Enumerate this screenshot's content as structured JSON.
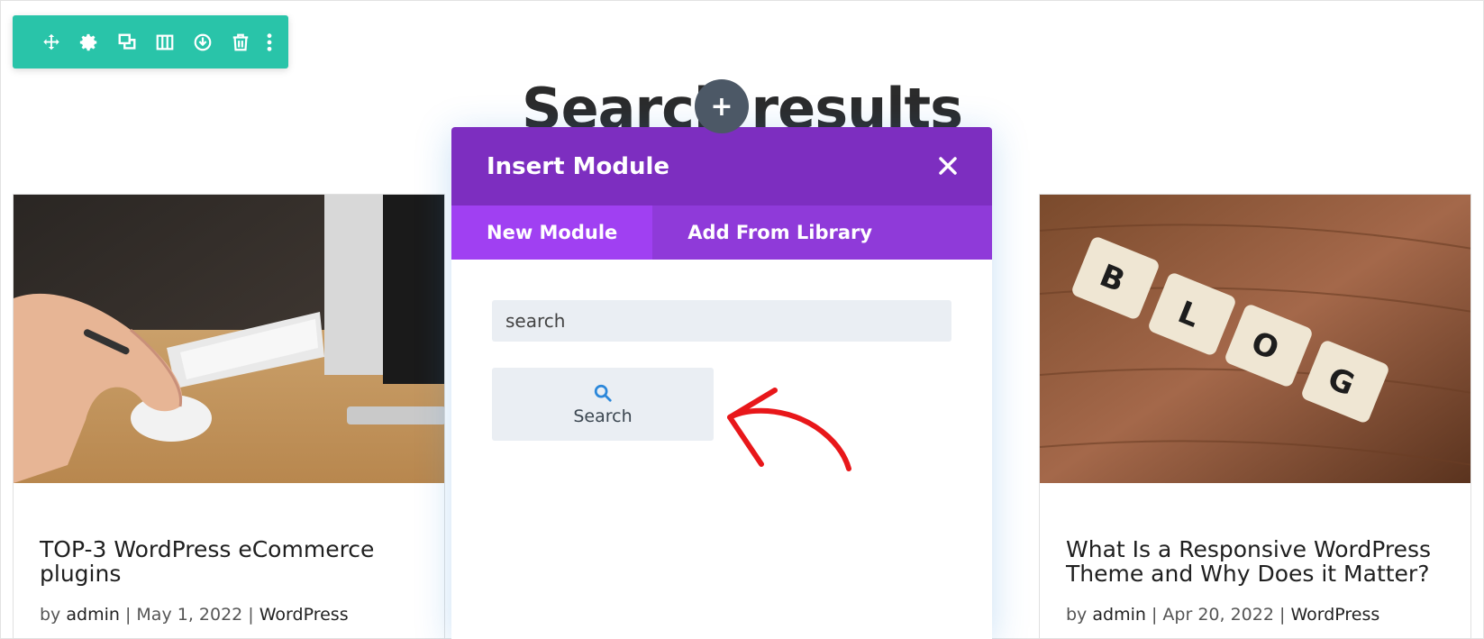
{
  "toolbar": {
    "icons": [
      "move-icon",
      "gear-icon",
      "duplicate-icon",
      "columns-icon",
      "save-to-library-icon",
      "trash-icon",
      "more-icon"
    ]
  },
  "section": {
    "title": "Search results"
  },
  "modal": {
    "title": "Insert Module",
    "tabs": [
      {
        "label": "New Module",
        "active": true
      },
      {
        "label": "Add From Library",
        "active": false
      }
    ],
    "search_value": "search",
    "modules": [
      {
        "label": "Search",
        "icon": "search-icon"
      }
    ]
  },
  "cards": [
    {
      "title": "TOP-3 WordPress eCommerce plugins",
      "by": "by",
      "author": "admin",
      "sep1": "|",
      "date": "May 1, 2022",
      "sep2": "|",
      "category": "WordPress"
    },
    {
      "title": "What Is a Responsive WordPress Theme and Why Does it Matter?",
      "by": "by",
      "author": "admin",
      "sep1": "|",
      "date": "Apr 20, 2022",
      "sep2": "|",
      "category": "WordPress"
    }
  ],
  "colors": {
    "toolbar": "#29c4a9",
    "modal_header": "#7d2ec0",
    "modal_tabs": "#8f3ad9",
    "active_tab": "#a040f2",
    "search_icon": "#2b87da",
    "annotation_arrow": "#e8171a"
  }
}
